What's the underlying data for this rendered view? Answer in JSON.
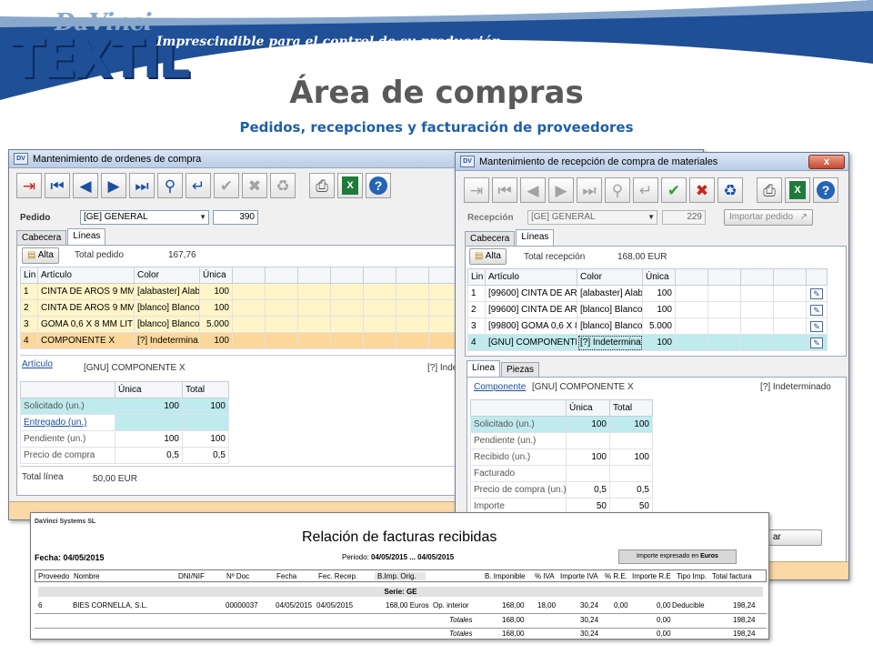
{
  "brand": {
    "davinci": "DaVinci",
    "textil": "TEXTIL",
    "tagline": "Imprescindible para el control de su producción"
  },
  "slide": {
    "title": "Área de compras",
    "subtitle": "Pedidos, recepciones y facturación de proveedores"
  },
  "colors": {
    "accent": "#1f5fa8",
    "title_grey": "#595959",
    "row_yellow": "#fff5c8",
    "row_orange": "#fcd79a",
    "row_cyan": "#bfeaee",
    "statusbar": "#fbd9a6"
  },
  "purchase_orders": {
    "title": "Mantenimiento de ordenes de compra",
    "toolbar_icons": [
      "exit-icon",
      "first-icon",
      "previous-icon",
      "next-icon",
      "last-icon",
      "search-icon",
      "return-icon",
      "confirm-icon",
      "cancel-icon",
      "recycle-icon",
      "print-icon",
      "excel-icon",
      "help-icon"
    ],
    "pedido_label": "Pedido",
    "pedido_series": "[GE] GENERAL",
    "pedido_number": "390",
    "tabs": [
      "Cabecera",
      "Líneas"
    ],
    "alta_label": "Alta",
    "total_pedido_label": "Total pedido",
    "total_pedido_value": "167,76",
    "lines": {
      "headers": [
        "Lin",
        "Artículo",
        "Color",
        "Única"
      ],
      "rows": [
        {
          "lin": "1",
          "articulo": "CINTA DE AROS 9 MM",
          "color": "[alabaster] Alab...",
          "unica": "100"
        },
        {
          "lin": "2",
          "articulo": "CINTA DE AROS 9 MM",
          "color": "[blanco] Blanco",
          "unica": "100"
        },
        {
          "lin": "3",
          "articulo": "GOMA 0,6 X 8 MM LIT",
          "color": "[blanco] Blanco",
          "unica": "5.000"
        },
        {
          "lin": "4",
          "articulo": "COMPONENTE X",
          "color": "[?]  Indetermina...",
          "unica": "100"
        }
      ]
    },
    "articulo_label": "Artículo",
    "articulo_value": "[GNU] COMPONENTE X",
    "color_value": "[?]  Inde",
    "qty": {
      "headers": [
        "Única",
        "Total"
      ],
      "rows": [
        {
          "label": "Solicitado (un.)",
          "unica": "100",
          "total": "100"
        },
        {
          "label": "Entregado (un.)",
          "unica": "",
          "total": ""
        },
        {
          "label": "Pendiente (un.)",
          "unica": "100",
          "total": "100"
        },
        {
          "label": "Precio de compra",
          "unica": "0,5",
          "total": "0,5"
        }
      ]
    },
    "total_linea_label": "Total línea",
    "total_linea_value": "50,00 EUR"
  },
  "receptions": {
    "title": "Mantenimiento de recepción de compra de materiales",
    "close_label": "x",
    "toolbar_icons": [
      "exit-icon",
      "first-icon",
      "previous-icon",
      "next-icon",
      "last-icon",
      "search-icon",
      "return-icon",
      "confirm-icon",
      "cancel-icon",
      "recycle-icon",
      "print-icon",
      "excel-icon",
      "help-icon"
    ],
    "recepcion_label": "Recepción",
    "recepcion_series": "[GE] GENERAL",
    "recepcion_number": "229",
    "importar_label": "Importar pedido",
    "tabs": [
      "Cabecera",
      "Líneas"
    ],
    "alta_label": "Alta",
    "total_recepcion_label": "Total recepción",
    "total_recepcion_value": "168,00 EUR",
    "lines": {
      "headers": [
        "Lin",
        "Artículo",
        "Color",
        "Única"
      ],
      "rows": [
        {
          "lin": "1",
          "articulo": "[99600] CINTA DE AR...",
          "color": "[alabaster] Alab...",
          "unica": "100"
        },
        {
          "lin": "2",
          "articulo": "[99600] CINTA DE AR...",
          "color": "[blanco] Blanco",
          "unica": "100"
        },
        {
          "lin": "3",
          "articulo": "[99800] GOMA 0,6 X 8 ...",
          "color": "[blanco] Blanco",
          "unica": "5.000"
        },
        {
          "lin": "4",
          "articulo": "[GNU] COMPONENTE X",
          "color": "[?]  Indetermina...",
          "unica": "100"
        }
      ]
    },
    "sub_tabs": [
      "Línea",
      "Piezas"
    ],
    "componente_label": "Componente",
    "componente_value": "[GNU] COMPONENTE X",
    "color_value": "[?]  Indeterminado",
    "qty": {
      "headers": [
        "Única",
        "Total"
      ],
      "rows": [
        {
          "label": "Solicitado (un.)",
          "unica": "100",
          "total": "100"
        },
        {
          "label": "Pendiente (un.)",
          "unica": "",
          "total": ""
        },
        {
          "label": "Recibido (un.)",
          "unica": "100",
          "total": "100"
        },
        {
          "label": "Facturado",
          "unica": "",
          "total": ""
        },
        {
          "label": "Precio de compra (un.)",
          "unica": "0,5",
          "total": "0,5"
        },
        {
          "label": "Importe",
          "unica": "50",
          "total": "50"
        }
      ]
    },
    "partial_button_label": "ar"
  },
  "report": {
    "company": "DaVinci Systems SL",
    "title": "Relación de facturas recibidas",
    "fecha_label": "Fecha: 04/05/2015",
    "periodo_label": "Periodo:",
    "periodo_value": "04/05/2015 ... 04/05/2015",
    "importe_label": "Importe expresado en",
    "importe_currency": "Euros",
    "headers": {
      "proveedor": "Proveedo",
      "nombre": "Nombre",
      "dni": "DNI/NIF",
      "ndoc": "Nº Doc",
      "fecha": "Fecha",
      "fec_recep": "Fec. Recep.",
      "bimp_orig": "B.Imp. Orig.",
      "b_imponible": "B. Imponible",
      "pct_iva": "% IVA",
      "importe_iva": "Importe IVA",
      "pct_re": "% R.E.",
      "importe_re": "Importe R.E",
      "tipo_imp": "Tipo Imp.",
      "total_factura": "Total factura"
    },
    "serie": "Serie: GE",
    "rows": [
      {
        "proveedor": "6",
        "nombre": "BIES CORNELLA, S.L.",
        "ndoc": "00000037",
        "fecha": "04/05/2015",
        "fec_recep": "04/05/2015",
        "bimp_orig": "168,00 Euros",
        "op": "Op. interior",
        "b_imponible": "168,00",
        "pct_iva": "18,00",
        "importe_iva": "30,24",
        "pct_re": "0,00",
        "importe_re": "0,00",
        "tipo_imp": "Deducible",
        "total_factura": "198,24"
      }
    ],
    "totals": [
      {
        "label": "Totales",
        "b_imponible": "168,00",
        "importe_iva": "30,24",
        "importe_re": "0,00",
        "total_factura": "198,24"
      },
      {
        "label": "Totales",
        "b_imponible": "168,00",
        "importe_iva": "30,24",
        "importe_re": "0,00",
        "total_factura": "198,24"
      }
    ]
  }
}
